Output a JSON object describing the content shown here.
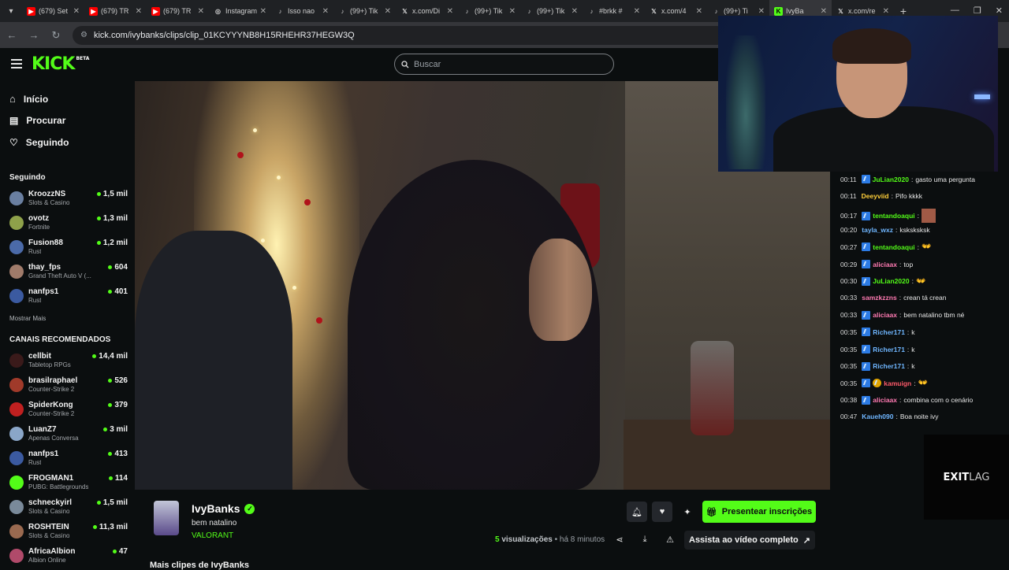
{
  "tabs": [
    {
      "label": "(679) Set",
      "icon": "youtube-icon",
      "color": "#ff0000"
    },
    {
      "label": "(679) TR",
      "icon": "youtube-icon",
      "color": "#ff0000"
    },
    {
      "label": "(679) TR",
      "icon": "youtube-icon",
      "color": "#ff0000"
    },
    {
      "label": "Instagram",
      "icon": "instagram-icon",
      "color": "#d0d0d0"
    },
    {
      "label": "Isso nao",
      "icon": "tiktok-icon",
      "color": "#d0d0d0"
    },
    {
      "label": "(99+) Tik",
      "icon": "tiktok-icon",
      "color": "#d0d0d0"
    },
    {
      "label": "x.com/Di",
      "icon": "x-icon",
      "color": "#d0d0d0"
    },
    {
      "label": "(99+) Tik",
      "icon": "tiktok-icon",
      "color": "#d0d0d0"
    },
    {
      "label": "(99+) Tik",
      "icon": "tiktok-icon",
      "color": "#d0d0d0"
    },
    {
      "label": "#brkk #",
      "icon": "tiktok-icon",
      "color": "#d0d0d0"
    },
    {
      "label": "x.com/4",
      "icon": "x-icon",
      "color": "#d0d0d0"
    },
    {
      "label": "(99+) Ti",
      "icon": "tiktok-icon",
      "color": "#d0d0d0"
    },
    {
      "label": "IvyBa",
      "icon": "kick-icon",
      "color": "#53fc18",
      "active": true
    },
    {
      "label": "x.com/re",
      "icon": "x-icon",
      "color": "#d0d0d0"
    }
  ],
  "url": "kick.com/ivybanks/clips/clip_01KCYYYNB8H15RHEHR37HEGW3Q",
  "logo": {
    "text": "KICK",
    "badge": "BETA"
  },
  "search": {
    "placeholder": "Buscar"
  },
  "nav": {
    "home": "Início",
    "browse": "Procurar",
    "following": "Seguindo"
  },
  "following_section": {
    "title": "Seguindo",
    "channels": [
      {
        "name": "KroozzNS",
        "category": "Slots & Casino",
        "viewers": "1,5 mil",
        "color": "#6a7fa0"
      },
      {
        "name": "ovotz",
        "category": "Fortnite",
        "viewers": "1,3 mil",
        "color": "#8ea14a"
      },
      {
        "name": "Fusion88",
        "category": "Rust",
        "viewers": "1,2 mil",
        "color": "#4b6aa8"
      },
      {
        "name": "thay_fps",
        "category": "Grand Theft Auto V (...",
        "viewers": "604",
        "color": "#a07b6a"
      },
      {
        "name": "nanfps1",
        "category": "Rust",
        "viewers": "401",
        "color": "#3b5aa0"
      }
    ],
    "more": "Mostrar Mais"
  },
  "recommended_section": {
    "title": "CANAIS RECOMENDADOS",
    "channels": [
      {
        "name": "cellbit",
        "category": "Tabletop RPGs",
        "viewers": "14,4 mil",
        "color": "#3a1a1a"
      },
      {
        "name": "brasilraphael",
        "category": "Counter-Strike 2",
        "viewers": "526",
        "color": "#a03a2a"
      },
      {
        "name": "SpiderKong",
        "category": "Counter-Strike 2",
        "viewers": "379",
        "color": "#c02020"
      },
      {
        "name": "LuanZ7",
        "category": "Apenas Conversa",
        "viewers": "3 mil",
        "color": "#8aa6c8"
      },
      {
        "name": "nanfps1",
        "category": "Rust",
        "viewers": "413",
        "color": "#3b5aa0"
      },
      {
        "name": "FROGMAN1",
        "category": "PUBG: Battlegrounds",
        "viewers": "114",
        "color": "#53fc18"
      },
      {
        "name": "schneckyirl",
        "category": "Slots & Casino",
        "viewers": "1,5 mil",
        "color": "#7a8a9a"
      },
      {
        "name": "ROSHTEIN",
        "category": "Slots & Casino",
        "viewers": "11,3 mil",
        "color": "#9a6a50"
      },
      {
        "name": "AfricaAlbion",
        "category": "Albion Online",
        "viewers": "47",
        "color": "#b04a6a"
      }
    ]
  },
  "chat": [
    {
      "time": "00:11",
      "user": "JuLian2020",
      "color": "#53fc18",
      "badge": "blue",
      "text": "gasto uma pergunta"
    },
    {
      "time": "00:11",
      "user": "Deeyviid",
      "color": "#ffcf3a",
      "badge": "",
      "text": "Pifo kkkk"
    },
    {
      "time": "00:17",
      "user": "tentandoaqui",
      "color": "#53fc18",
      "badge": "blue",
      "text": "",
      "emote": true
    },
    {
      "time": "00:20",
      "user": "tayla_wxz",
      "color": "#6fb6ff",
      "badge": "",
      "text": "ksksksksk"
    },
    {
      "time": "00:27",
      "user": "tentandoaqui",
      "color": "#53fc18",
      "badge": "blue",
      "text": "",
      "hand": "👐"
    },
    {
      "time": "00:29",
      "user": "aliciaax",
      "color": "#ff7ab2",
      "badge": "blue",
      "text": "top"
    },
    {
      "time": "00:30",
      "user": "JuLian2020",
      "color": "#53fc18",
      "badge": "blue",
      "text": "",
      "hand": "👐"
    },
    {
      "time": "00:33",
      "user": "samzkzzns",
      "color": "#ff7ab2",
      "badge": "",
      "text": "crean tá crean"
    },
    {
      "time": "00:33",
      "user": "aliciaax",
      "color": "#ff7ab2",
      "badge": "blue",
      "text": "bem natalino tbm né"
    },
    {
      "time": "00:35",
      "user": "Richer171",
      "color": "#6fb6ff",
      "badge": "blue",
      "text": "k"
    },
    {
      "time": "00:35",
      "user": "Richer171",
      "color": "#6fb6ff",
      "badge": "blue",
      "text": "k"
    },
    {
      "time": "00:35",
      "user": "Richer171",
      "color": "#6fb6ff",
      "badge": "blue",
      "text": "k"
    },
    {
      "time": "00:35",
      "user": "kamuign",
      "color": "#ff5a6a",
      "badge": "blue+gold",
      "text": "",
      "hand": "👐"
    },
    {
      "time": "00:38",
      "user": "aliciaax",
      "color": "#ff7ab2",
      "badge": "blue",
      "text": "combina com o cenário"
    },
    {
      "time": "00:47",
      "user": "Kaueh090",
      "color": "#6fb6ff",
      "badge": "",
      "text": "Boa noite ivy"
    }
  ],
  "exitlag": {
    "exit": "EXIT",
    "lag": "LAG"
  },
  "clip": {
    "streamer": "IvyBanks",
    "title": "bem natalino",
    "game": "VALORANT",
    "subscribe_label": "Presentear inscrições",
    "views_count": "5",
    "views_label": "visualizações",
    "time_ago": "há 8 minutos",
    "watch_label": "Assista ao vídeo completo",
    "more_clips": "Mais clipes de IvyBanks"
  }
}
